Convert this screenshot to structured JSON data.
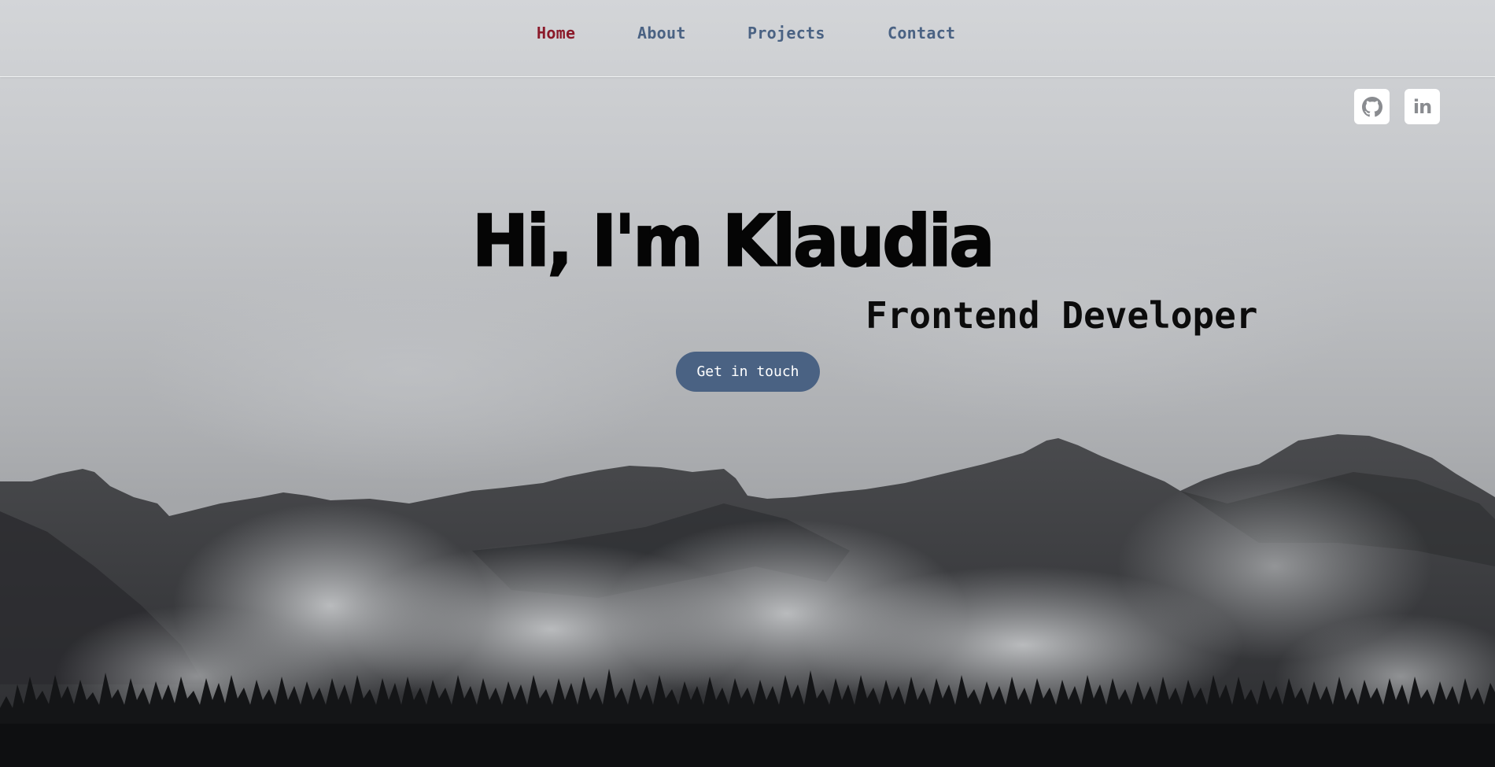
{
  "nav": {
    "items": [
      {
        "label": "Home",
        "active": true
      },
      {
        "label": "About",
        "active": false
      },
      {
        "label": "Projects",
        "active": false
      },
      {
        "label": "Contact",
        "active": false
      }
    ]
  },
  "social": {
    "github_icon": "github-icon",
    "linkedin_icon": "linkedin-icon",
    "linkedin_text": "in"
  },
  "hero": {
    "headline": "Hi, I'm Klaudia",
    "subtitle": "Frontend Developer",
    "cta_label": "Get in touch",
    "background": "misty-mountains-with-pine-forest"
  },
  "colors": {
    "accent_active": "#8b1a2a",
    "accent_primary": "#4a6283",
    "headline": "#050505"
  }
}
